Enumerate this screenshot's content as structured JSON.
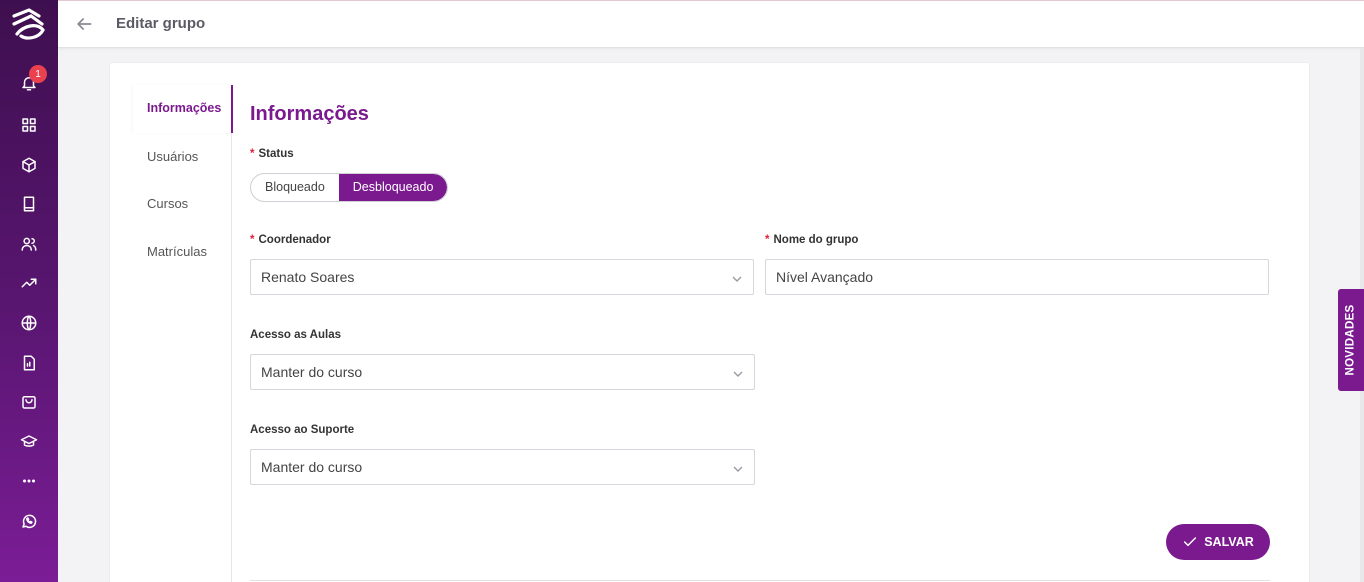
{
  "header": {
    "title": "Editar grupo"
  },
  "sidebar": {
    "notification_count": "1"
  },
  "tabs": [
    {
      "label": "Informações"
    },
    {
      "label": "Usuários"
    },
    {
      "label": "Cursos"
    },
    {
      "label": "Matrículas"
    }
  ],
  "form": {
    "title": "Informações",
    "status": {
      "label": "Status",
      "options": [
        "Bloqueado",
        "Desbloqueado"
      ],
      "selected": "Desbloqueado"
    },
    "coordenador": {
      "label": "Coordenador",
      "value": "Renato Soares"
    },
    "nome_grupo": {
      "label": "Nome do grupo",
      "value": "Nível Avançado"
    },
    "acesso_aulas": {
      "label": "Acesso as Aulas",
      "value": "Manter do curso"
    },
    "acesso_suporte": {
      "label": "Acesso ao Suporte",
      "value": "Manter do curso"
    },
    "required_mark": "*",
    "save_label": "SALVAR"
  },
  "novidades_label": "NOVIDADES",
  "colors": {
    "brand": "#7b1a8f",
    "required": "#e0203a",
    "sidebar": "#5a1672"
  }
}
